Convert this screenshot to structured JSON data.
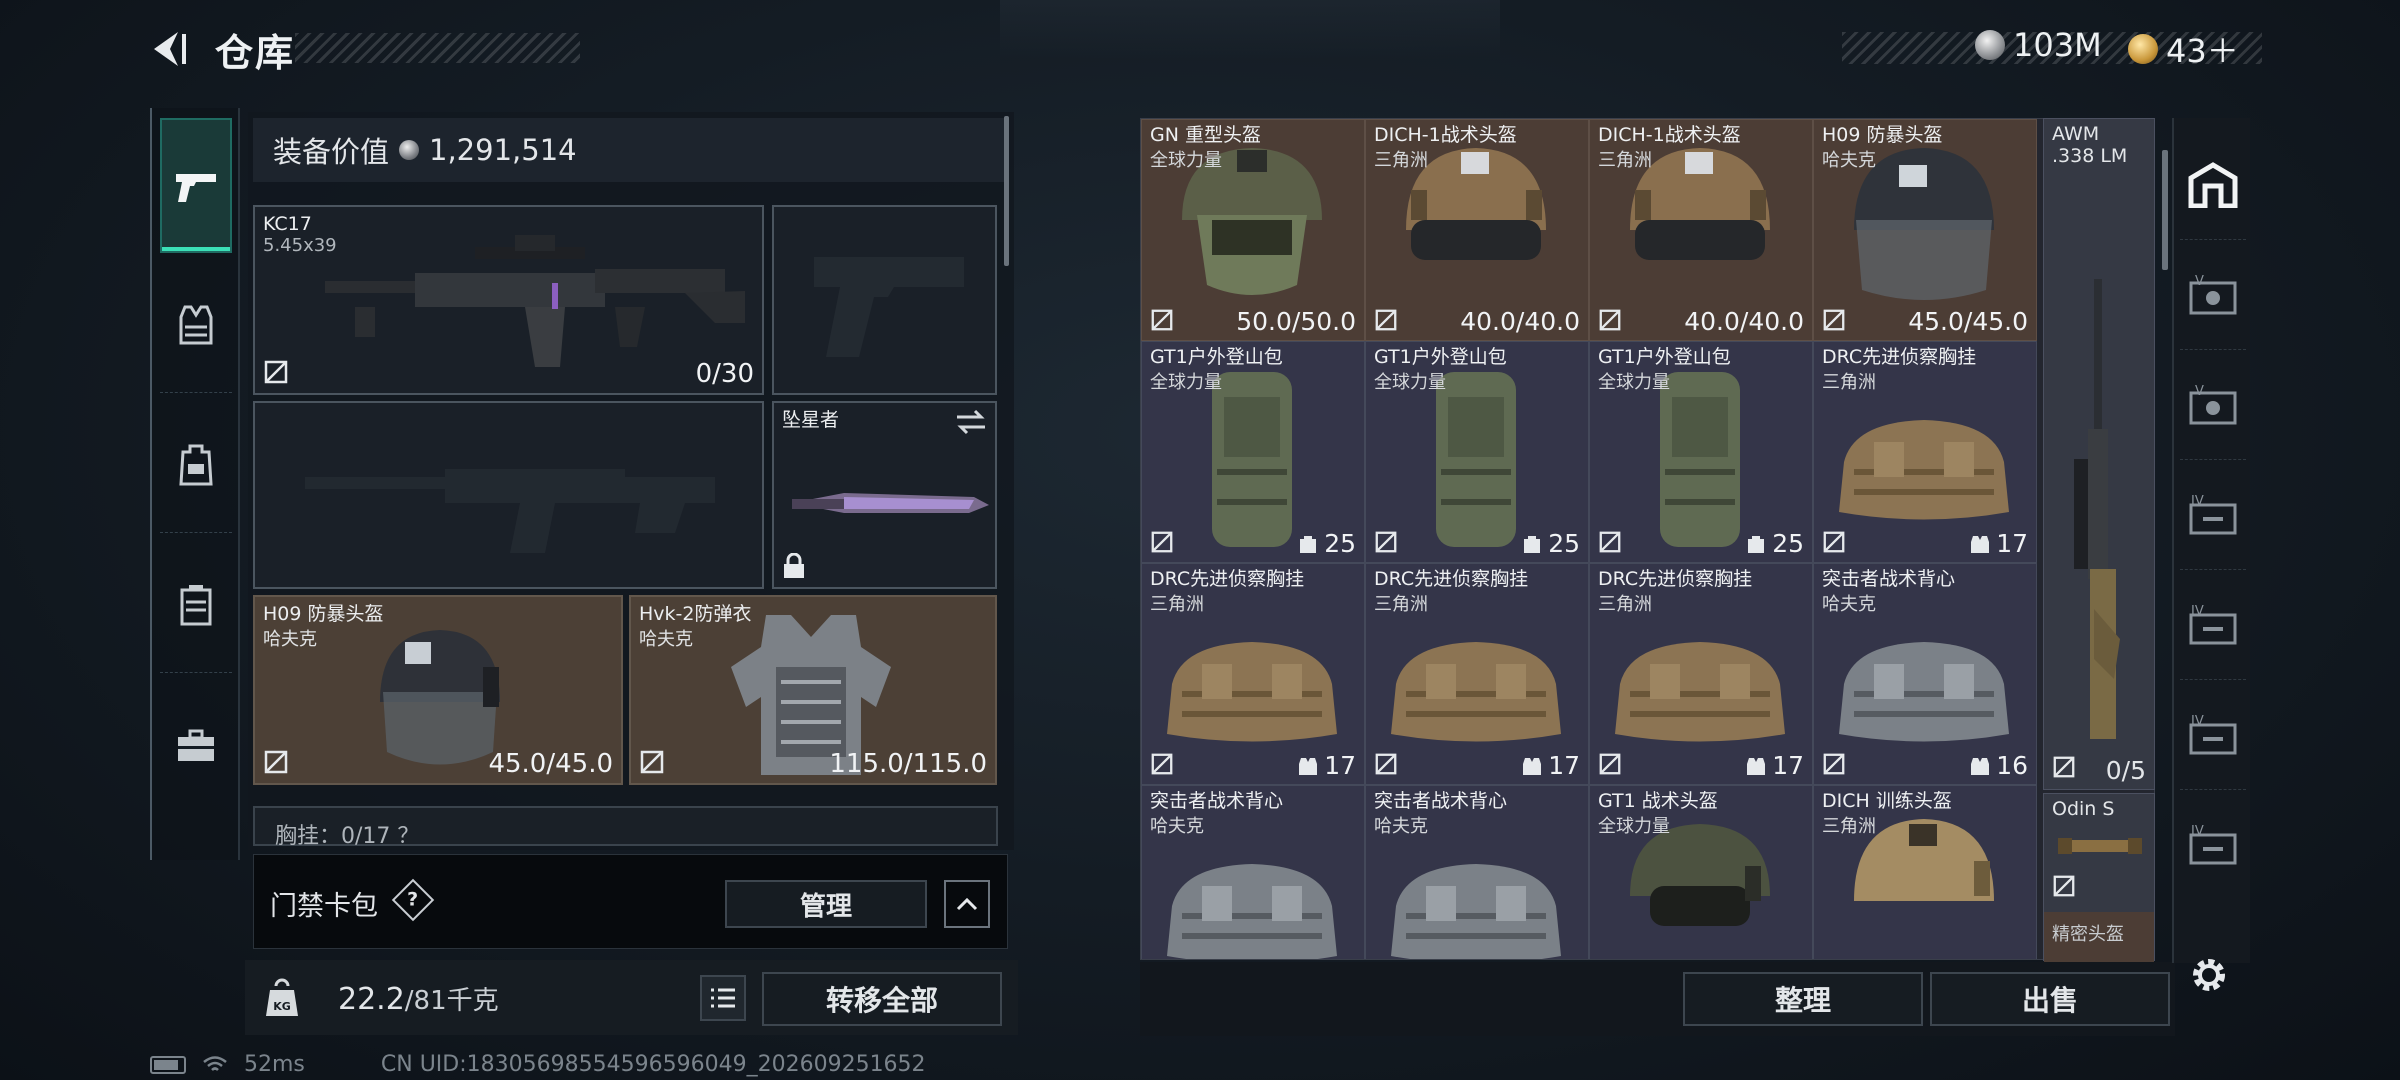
{
  "header": {
    "title": "仓库",
    "currency": [
      {
        "value": "103M"
      },
      {
        "value": "43＋"
      }
    ]
  },
  "equipment": {
    "value_label": "装备价值",
    "value": "1,291,514",
    "primary": {
      "name": "KC17",
      "caliber": "5.45x39",
      "ammo": "0/30"
    },
    "melee": {
      "name": "坠星者"
    },
    "helmet": {
      "name": "H09 防暴头盔",
      "origin": "哈夫克",
      "durability": "45.0/45.0"
    },
    "armor": {
      "name": "Hvk-2防弹衣",
      "origin": "哈夫克",
      "durability": "115.0/115.0"
    },
    "chest_partial": "胸挂：0/17 ？"
  },
  "access_card": {
    "label": "门禁卡包",
    "help": "?",
    "manage": "管理"
  },
  "weight": {
    "current": "22.2",
    "max": "/81千克"
  },
  "buttons": {
    "transfer_all": "转移全部",
    "sort": "整理",
    "sell": "出售"
  },
  "status": {
    "ping": "52ms",
    "uid": "CN UID:18305698554596596049_202609251652"
  },
  "storage": {
    "items": [
      {
        "name": "GN 重型头盔",
        "origin": "全球力量",
        "value": "50.0/50.0",
        "kind": "helmet-green"
      },
      {
        "name": "DICH-1战术头盔",
        "origin": "三角洲",
        "value": "40.0/40.0",
        "kind": "helmet-tan"
      },
      {
        "name": "DICH-1战术头盔",
        "origin": "三角洲",
        "value": "40.0/40.0",
        "kind": "helmet-tan"
      },
      {
        "name": "H09 防暴头盔",
        "origin": "哈夫克",
        "value": "45.0/45.0",
        "kind": "helmet-grey"
      },
      {
        "name": "GT1户外登山包",
        "origin": "全球力量",
        "value": "25",
        "kind": "backpack"
      },
      {
        "name": "GT1户外登山包",
        "origin": "全球力量",
        "value": "25",
        "kind": "backpack"
      },
      {
        "name": "GT1户外登山包",
        "origin": "全球力量",
        "value": "25",
        "kind": "backpack"
      },
      {
        "name": "DRC先进侦察胸挂",
        "origin": "三角洲",
        "value": "17",
        "kind": "rig-tan"
      },
      {
        "name": "DRC先进侦察胸挂",
        "origin": "三角洲",
        "value": "17",
        "kind": "rig-tan"
      },
      {
        "name": "DRC先进侦察胸挂",
        "origin": "三角洲",
        "value": "17",
        "kind": "rig-tan"
      },
      {
        "name": "DRC先进侦察胸挂",
        "origin": "三角洲",
        "value": "17",
        "kind": "rig-tan"
      },
      {
        "name": "突击者战术背心",
        "origin": "哈夫克",
        "value": "16",
        "kind": "rig-grey"
      },
      {
        "name": "突击者战术背心",
        "origin": "哈夫克",
        "value": "",
        "kind": "rig-grey"
      },
      {
        "name": "突击者战术背心",
        "origin": "哈夫克",
        "value": "",
        "kind": "rig-grey"
      },
      {
        "name": "GT1 战术头盔",
        "origin": "全球力量",
        "value": "",
        "kind": "helmet-dark"
      },
      {
        "name": "DICH 训练头盔",
        "origin": "三角洲",
        "value": "",
        "kind": "helmet-tan2"
      }
    ],
    "awm": {
      "name": "AWM",
      ".": "",
      "caliber": ".338 LM",
      "ammo": "0/5"
    },
    "odin": {
      "name": "Odin S",
      "tag": "精密头盔"
    }
  },
  "colors": {
    "accent": "#3be0b7",
    "brown_cell": "#4c3d35",
    "purple_cell": "#343549"
  }
}
